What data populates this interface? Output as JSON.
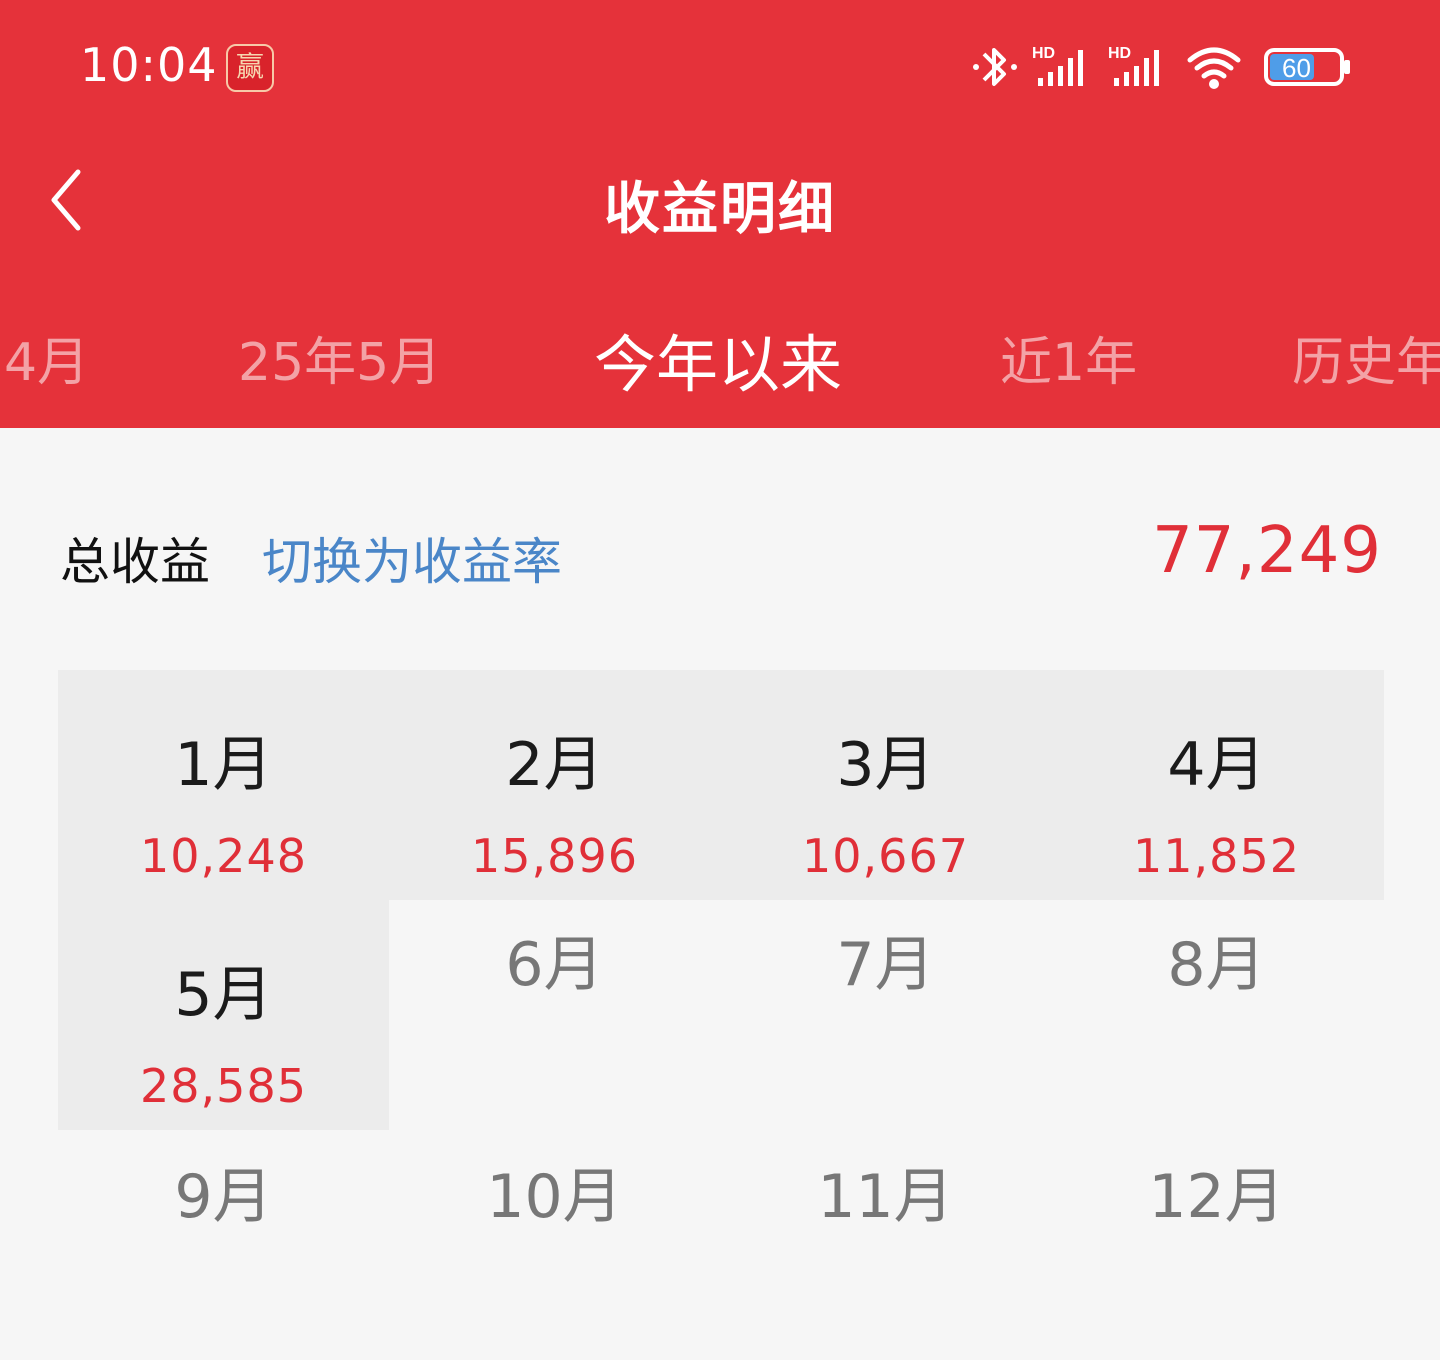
{
  "status_bar": {
    "time": "10:04",
    "app_badge_glyph": "赢",
    "icons": [
      "bluetooth-icon",
      "signal-hd-1-icon",
      "signal-hd-2-icon",
      "wifi-icon",
      "battery-icon"
    ],
    "network_label_1": "HD",
    "network_label_2": "HD",
    "battery_level": "60"
  },
  "nav": {
    "back_icon": "chevron-left-icon",
    "title": "收益明细"
  },
  "tabs": [
    {
      "label": "4月",
      "active": false
    },
    {
      "label": "25年5月",
      "active": false
    },
    {
      "label": "今年以来",
      "active": true
    },
    {
      "label": "近1年",
      "active": false
    },
    {
      "label": "历史年",
      "active": false
    }
  ],
  "summary": {
    "label": "总收益",
    "switch_link": "切换为收益率",
    "value": "77,249"
  },
  "months": [
    {
      "name": "1月",
      "value": "10,248",
      "has_data": true
    },
    {
      "name": "2月",
      "value": "15,896",
      "has_data": true
    },
    {
      "name": "3月",
      "value": "10,667",
      "has_data": true
    },
    {
      "name": "4月",
      "value": "11,852",
      "has_data": true
    },
    {
      "name": "5月",
      "value": "28,585",
      "has_data": true
    },
    {
      "name": "6月",
      "value": "",
      "has_data": false
    },
    {
      "name": "7月",
      "value": "",
      "has_data": false
    },
    {
      "name": "8月",
      "value": "",
      "has_data": false
    },
    {
      "name": "9月",
      "value": "",
      "has_data": false
    },
    {
      "name": "10月",
      "value": "",
      "has_data": false
    },
    {
      "name": "11月",
      "value": "",
      "has_data": false
    },
    {
      "name": "12月",
      "value": "",
      "has_data": false
    }
  ],
  "colors": {
    "header_red": "#e5323a",
    "value_red": "#e02f38",
    "link_blue": "#4a86c8",
    "background": "#f6f6f6",
    "cell_highlight": "#ececec"
  }
}
